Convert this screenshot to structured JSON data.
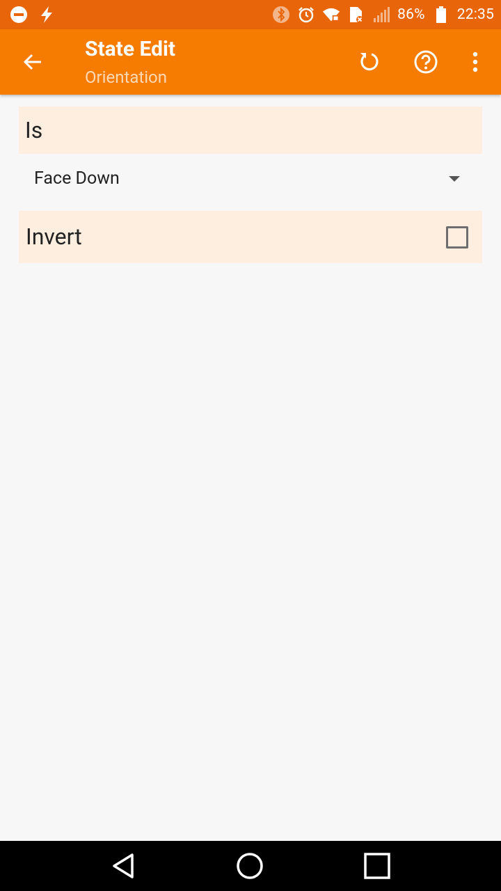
{
  "status_bar": {
    "battery_percent": "86%",
    "time": "22:35",
    "left_icons": [
      "do-not-disturb-icon",
      "flash-icon"
    ],
    "right_icons": [
      "bluetooth-icon",
      "alarm-icon",
      "wifi-icon",
      "sim-icon",
      "signal-icon",
      "battery-icon"
    ]
  },
  "app_bar": {
    "title": "State Edit",
    "subtitle": "Orientation",
    "actions": [
      "back-arrow-icon",
      "refresh-icon",
      "help-icon",
      "more-vert-icon"
    ]
  },
  "form": {
    "is_label": "Is",
    "is_value": "Face Down",
    "invert_label": "Invert",
    "invert_checked": false
  },
  "nav_bar": {
    "buttons": [
      "back-triangle-icon",
      "home-circle-icon",
      "recents-square-icon"
    ]
  },
  "colors": {
    "status_bar": "#e8650a",
    "app_bar": "#f57c00",
    "section_bg": "#fdeee0",
    "page_bg": "#f7f7f7"
  }
}
